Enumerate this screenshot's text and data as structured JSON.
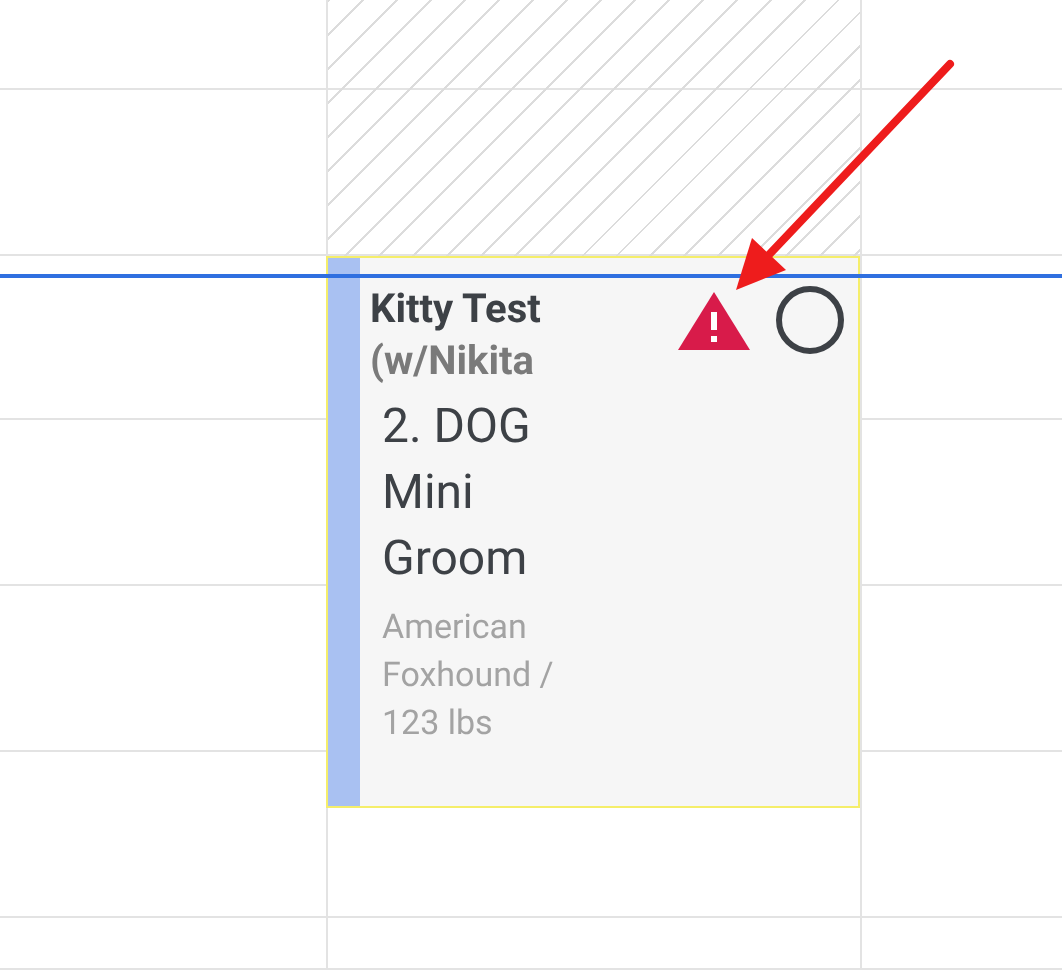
{
  "calendar": {
    "blocked": true
  },
  "appointment": {
    "title": "Kitty Test",
    "subtitle": "(w/Nikita",
    "service": "2. DOG Mini Groom",
    "details": "American Foxhound / 123 lbs",
    "warning": true,
    "checked": false,
    "highlighted": true
  }
}
